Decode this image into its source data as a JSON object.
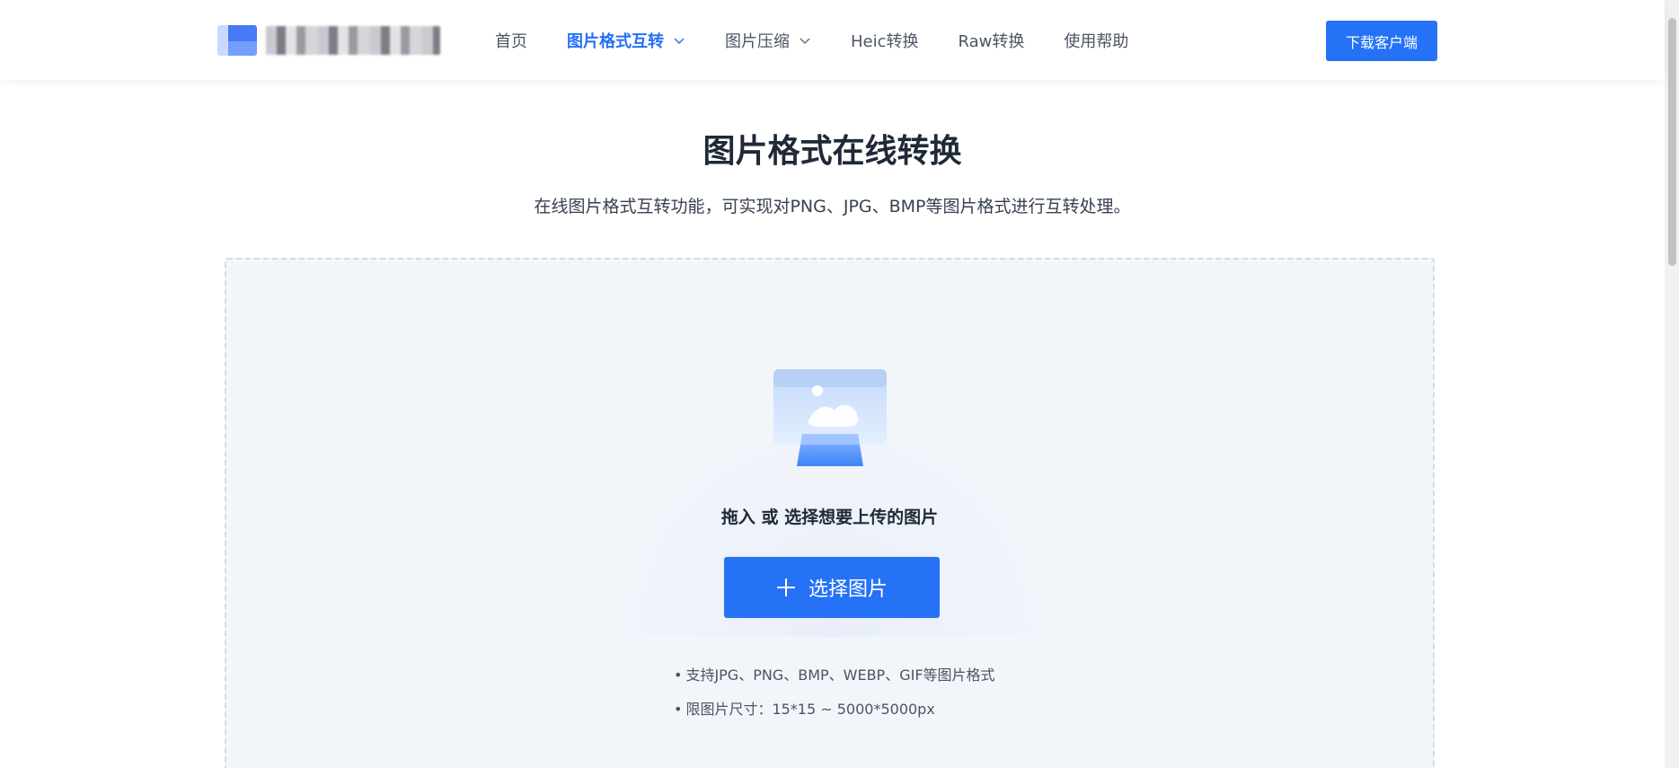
{
  "header": {
    "nav": [
      {
        "label": "首页",
        "active": false,
        "dropdown": false
      },
      {
        "label": "图片格式互转",
        "active": true,
        "dropdown": true
      },
      {
        "label": "图片压缩",
        "active": false,
        "dropdown": true
      },
      {
        "label": "Heic转换",
        "active": false,
        "dropdown": false
      },
      {
        "label": "Raw转换",
        "active": false,
        "dropdown": false
      },
      {
        "label": "使用帮助",
        "active": false,
        "dropdown": false
      }
    ],
    "download_label": "下载客户端"
  },
  "hero": {
    "title": "图片格式在线转换",
    "description": "在线图片格式互转功能，可实现对PNG、JPG、BMP等图片格式进行互转处理。"
  },
  "upload": {
    "drop_text": "拖入 或 选择想要上传的图片",
    "select_label": "选择图片",
    "tips": [
      "支持JPG、PNG、BMP、WEBP、GIF等图片格式",
      "限图片尺寸：15*15 ~ 5000*5000px"
    ],
    "tip_bullet": "•"
  },
  "colors": {
    "accent": "#2670f5",
    "upload_bg": "#f2f5f9",
    "text_dark": "#1f2937"
  },
  "icons": {
    "logo": "brand-logo-icon",
    "dropdown": "chevron-down-icon",
    "upload": "image-monitor-icon",
    "add": "plus-icon"
  }
}
